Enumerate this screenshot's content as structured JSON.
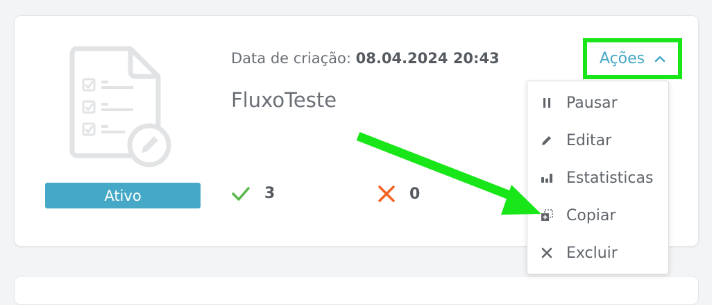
{
  "card": {
    "created_label": "Data de criação:",
    "created_value": "08.04.2024 20:43",
    "flow_name": "FluxoTeste",
    "status": "Ativo",
    "success_count": "3",
    "error_count": "0",
    "actions_label": "Ações"
  },
  "menu": {
    "items": [
      {
        "label": "Pausar",
        "icon": "pause-icon"
      },
      {
        "label": "Editar",
        "icon": "pencil-icon"
      },
      {
        "label": "Estatisticas",
        "icon": "bar-chart-icon"
      },
      {
        "label": "Copiar",
        "icon": "copy-icon"
      },
      {
        "label": "Excluir",
        "icon": "close-icon"
      }
    ]
  },
  "colors": {
    "accent": "#45a8c6",
    "success": "#58b84a",
    "error": "#f26322",
    "highlight": "#19e619"
  }
}
